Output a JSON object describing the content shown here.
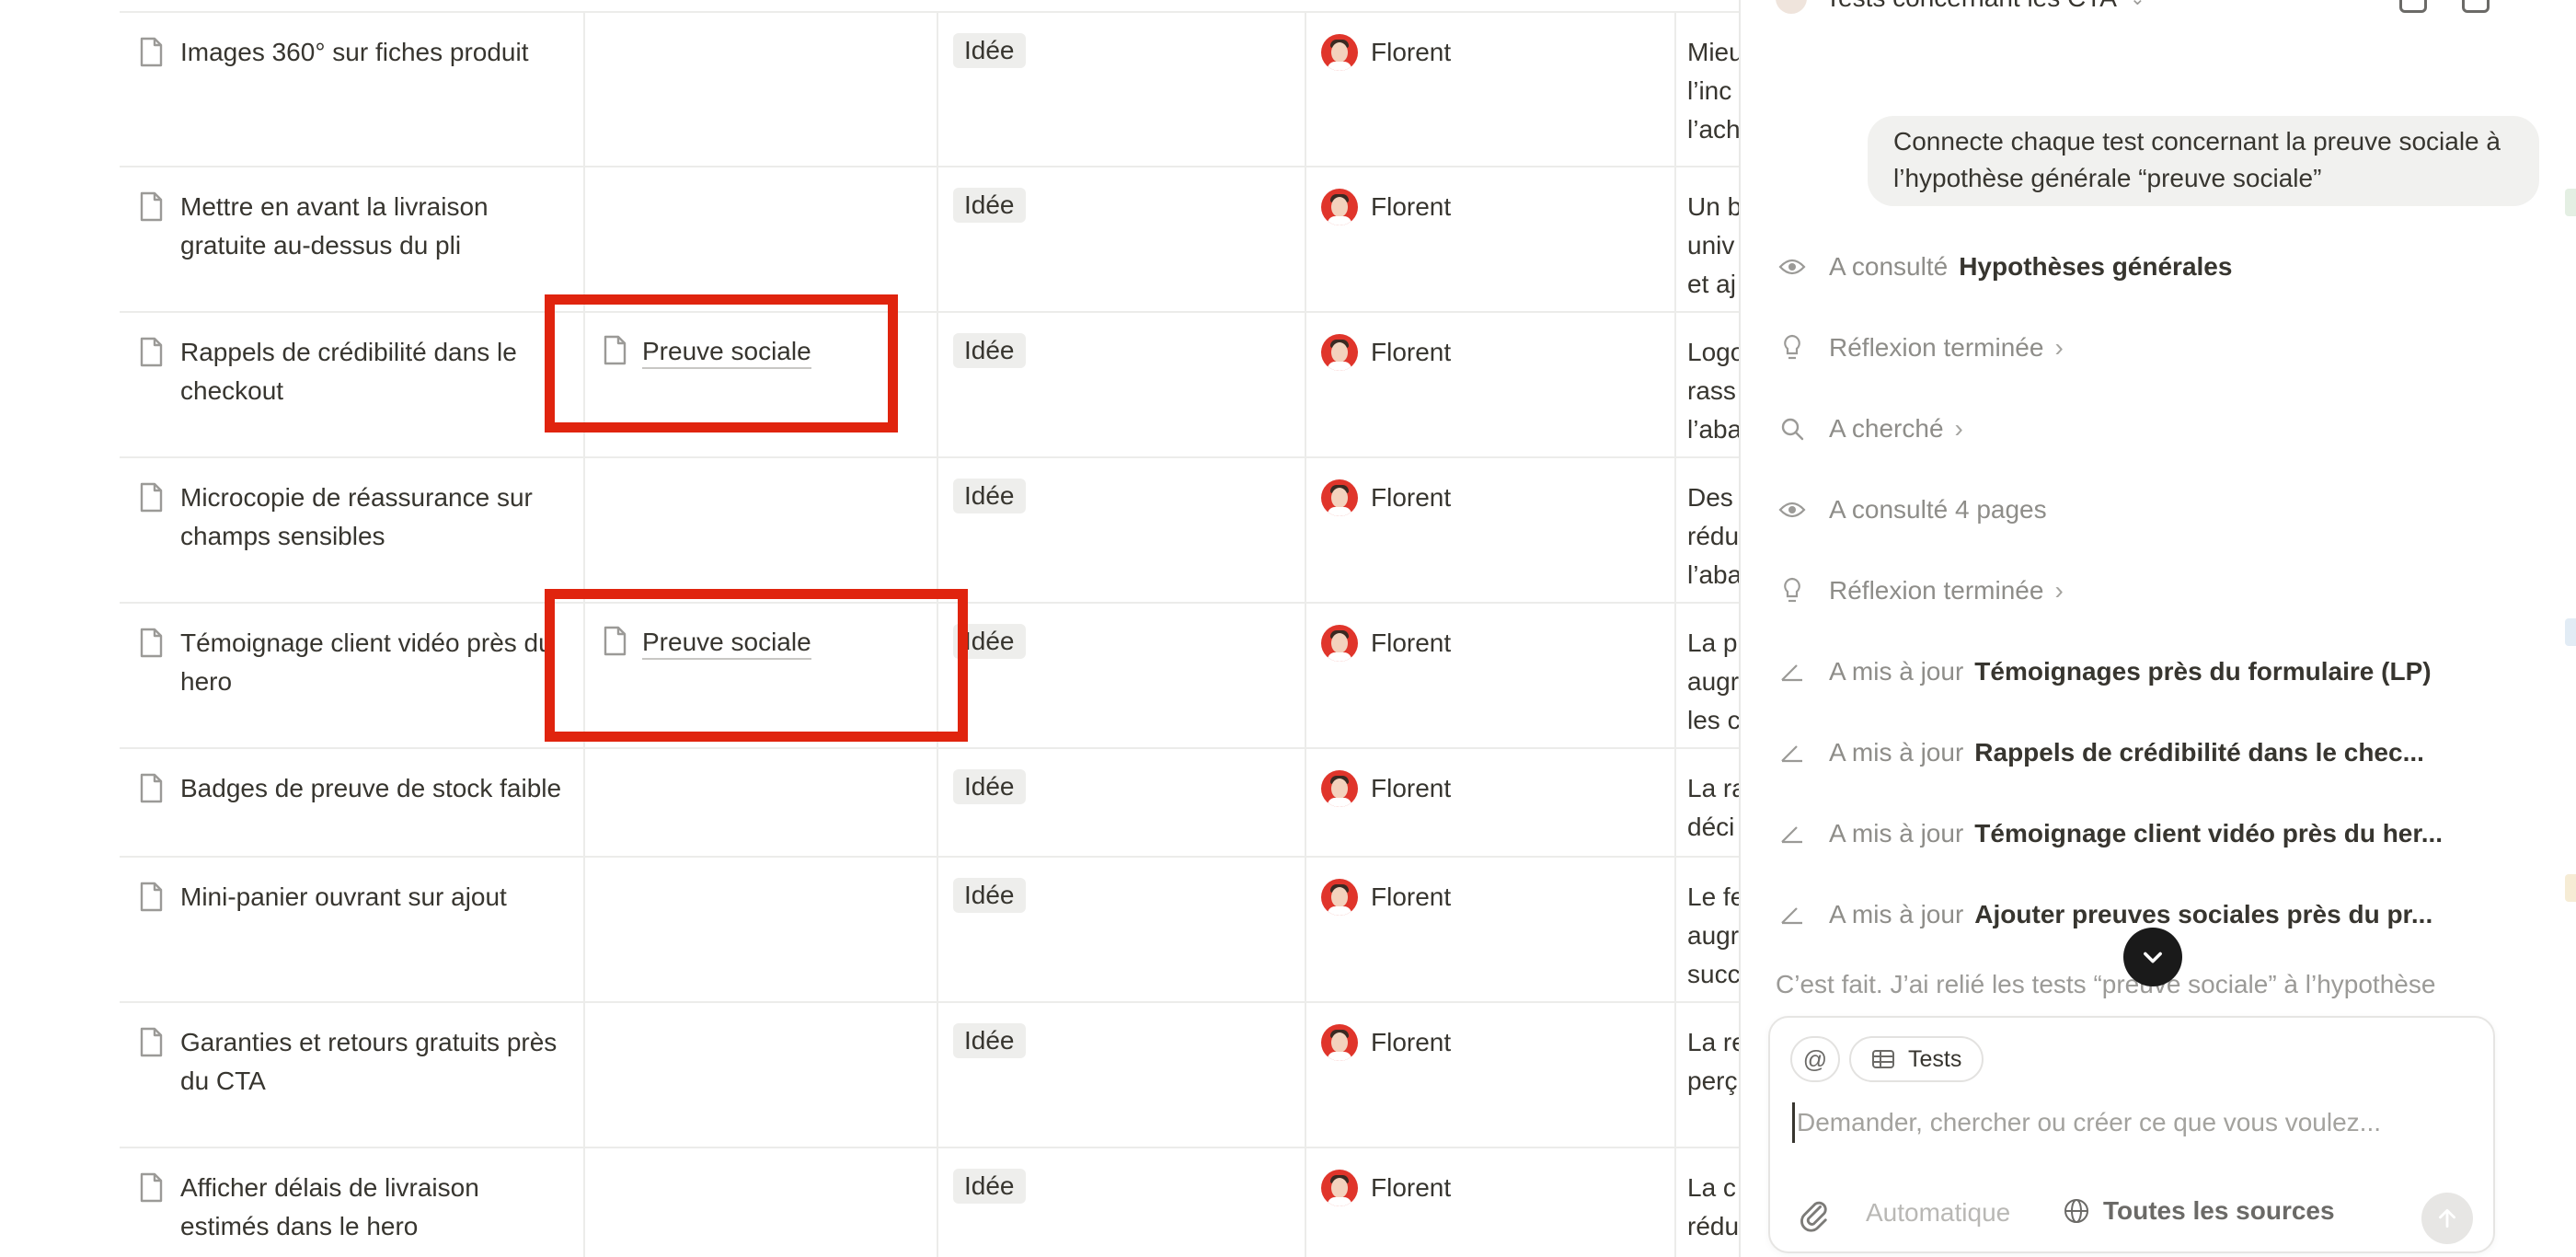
{
  "table": {
    "rows": [
      {
        "title": "Images 360° sur fiches produit",
        "relation": "",
        "status": "Idée",
        "assignee": "Florent",
        "desc": "Mieu\nl’inc\nl’ach"
      },
      {
        "title": "Mettre en avant la livraison gratuite au-dessus du pli",
        "relation": "",
        "status": "Idée",
        "assignee": "Florent",
        "desc": "Un b\nuniv\net aj"
      },
      {
        "title": "Rappels de crédibilité dans le checkout",
        "relation": "Preuve sociale",
        "status": "Idée",
        "assignee": "Florent",
        "desc": "Logo\nrass\nl’aba"
      },
      {
        "title": "Microcopie de réassurance sur champs sensibles",
        "relation": "",
        "status": "Idée",
        "assignee": "Florent",
        "desc": "Des\nrédu\nl’aba"
      },
      {
        "title": "Témoignage client vidéo près du hero",
        "relation": "Preuve sociale",
        "status": "Idée",
        "assignee": "Florent",
        "desc": "La p\naugr\nles c"
      },
      {
        "title": "Badges de preuve de stock faible",
        "relation": "",
        "status": "Idée",
        "assignee": "Florent",
        "desc": "La ra\ndéci"
      },
      {
        "title": "Mini-panier ouvrant sur ajout",
        "relation": "",
        "status": "Idée",
        "assignee": "Florent",
        "desc": "Le fe\naugr\nsucc"
      },
      {
        "title": "Garanties et retours gratuits près du CTA",
        "relation": "",
        "status": "Idée",
        "assignee": "Florent",
        "desc": "La re\nperç"
      },
      {
        "title": "Afficher délais de livraison estimés dans le hero",
        "relation": "",
        "status": "Idée",
        "assignee": "Florent",
        "desc": "La c\nrédu\naugr"
      }
    ]
  },
  "panel": {
    "header_title": "Tests concernant les CTA",
    "user_message": "Connecte chaque test concernant la preuve sociale à l’hypothèse générale “preuve sociale”",
    "steps": [
      {
        "icon": "eye-icon",
        "verb": "A consulté",
        "object": "Hypothèses générales",
        "chevron": false
      },
      {
        "icon": "lightbulb-icon",
        "verb": "Réflexion terminée",
        "object": "",
        "chevron": true
      },
      {
        "icon": "search-icon",
        "verb": "A cherché",
        "object": "",
        "chevron": true
      },
      {
        "icon": "eye-icon",
        "verb": "A consulté 4 pages",
        "object": "",
        "chevron": false
      },
      {
        "icon": "lightbulb-icon",
        "verb": "Réflexion terminée",
        "object": "",
        "chevron": true
      },
      {
        "icon": "edit-icon",
        "verb": "A mis à jour",
        "object": "Témoignages près du formulaire (LP)",
        "chevron": false
      },
      {
        "icon": "edit-icon",
        "verb": "A mis à jour",
        "object": "Rappels de crédibilité dans le chec...",
        "chevron": false
      },
      {
        "icon": "edit-icon",
        "verb": "A mis à jour",
        "object": "Témoignage client vidéo près du her...",
        "chevron": false
      },
      {
        "icon": "edit-icon",
        "verb": "A mis à jour",
        "object": "Ajouter preuves sociales près du pr...",
        "chevron": false
      }
    ],
    "final_text": "C’est fait. J’ai relié les tests “preuve sociale” à l’hypothèse",
    "composer": {
      "at_label": "@",
      "context_chip": "Tests",
      "placeholder": "Demander, chercher ou créer ce que vous voulez...",
      "mode_label": "Automatique",
      "sources_label": "Toutes les sources"
    }
  },
  "colors": {
    "highlight": "#e0240e",
    "text": "#37352f",
    "muted": "#8e8d89",
    "pill_bg": "#eeeeec",
    "avatar": "#e0352b"
  }
}
